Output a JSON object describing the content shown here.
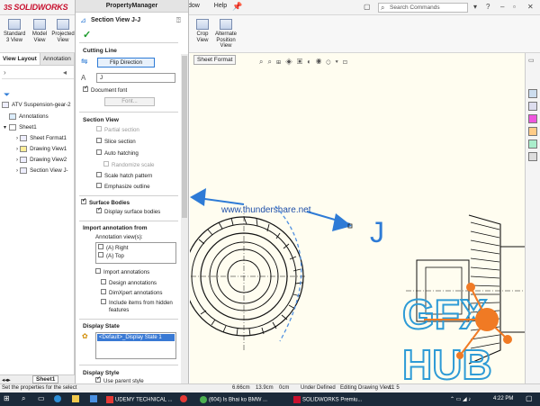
{
  "app": {
    "logo_text": "SOLIDWORKS",
    "menu": [
      "dow",
      "Help"
    ],
    "search_placeholder": "Search Commands"
  },
  "ribbon": {
    "buttons": [
      {
        "label": "Standard\n3 View"
      },
      {
        "label": "Model\nView"
      },
      {
        "label": "Projected\nView"
      },
      {
        "label": "Crop\nView"
      },
      {
        "label": "Alternate\nPosition\nView"
      }
    ]
  },
  "tree": {
    "tabs": [
      "View Layout",
      "Annotation"
    ],
    "items": [
      "ATV Suspension-gear-2",
      "Annotations",
      "Sheet1",
      "Sheet Format1",
      "Drawing View1",
      "Drawing View2",
      "Section View J-"
    ],
    "bottom_tab": "Sheet1"
  },
  "property_manager": {
    "header": "PropertyManager",
    "title": "Section View J-J",
    "cutting_line": {
      "label": "Cutting Line",
      "flip_button": "Flip Direction",
      "letter_value": "J",
      "document_font": "Document font",
      "font_button": "Font..."
    },
    "section_view": {
      "label": "Section View",
      "options": [
        {
          "label": "Partial section",
          "checked": false,
          "disabled": true
        },
        {
          "label": "Slice section",
          "checked": false,
          "disabled": false
        },
        {
          "label": "Auto hatching",
          "checked": false,
          "disabled": false
        },
        {
          "label": "Randomize scale",
          "checked": false,
          "disabled": true
        },
        {
          "label": "Scale hatch pattern",
          "checked": false,
          "disabled": false
        },
        {
          "label": "Emphasize outline",
          "checked": false,
          "disabled": false
        }
      ]
    },
    "surface_bodies": {
      "label": "Surface Bodies",
      "option": "Display surface bodies"
    },
    "import_annotation": {
      "label": "Import annotation from",
      "views_label": "Annotation view(s):",
      "views": [
        "(A) Right",
        "(A) Top"
      ],
      "import_annotations": "Import annotations",
      "design_annotations": "Design annotations",
      "dimxpert": "DimXpert annotations",
      "hidden_1": "Include items from hidden",
      "hidden_2": "features"
    },
    "display_state": {
      "label": "Display State",
      "value": "<Default>_Display State 1"
    },
    "display_style": {
      "label": "Display Style",
      "use_parent": "Use parent style"
    }
  },
  "canvas": {
    "sheet_format_tab": "Sheet Format",
    "watermark": "www.thundershare.net",
    "section_letter": "J",
    "gfx_logo_1": "GFX",
    "gfx_logo_2": "HUB"
  },
  "status": {
    "left": "Set the properties for the select",
    "x": "6.66cm",
    "y": "13.9cm",
    "z": "0cm",
    "state": "Under Defined",
    "editing": "Editing Drawing View1",
    "scale": "1 : 5"
  },
  "taskbar": {
    "items": [
      "UDEMY TECHNICAL ...",
      "(604) Is Bhai ko BMW ...",
      "SOLIDWORKS Premiu..."
    ],
    "time": "4:22 PM"
  },
  "colors": {
    "accent_blue": "#2e7bd6",
    "brand_red": "#c8102e",
    "gfx_orange": "#f07a24"
  }
}
